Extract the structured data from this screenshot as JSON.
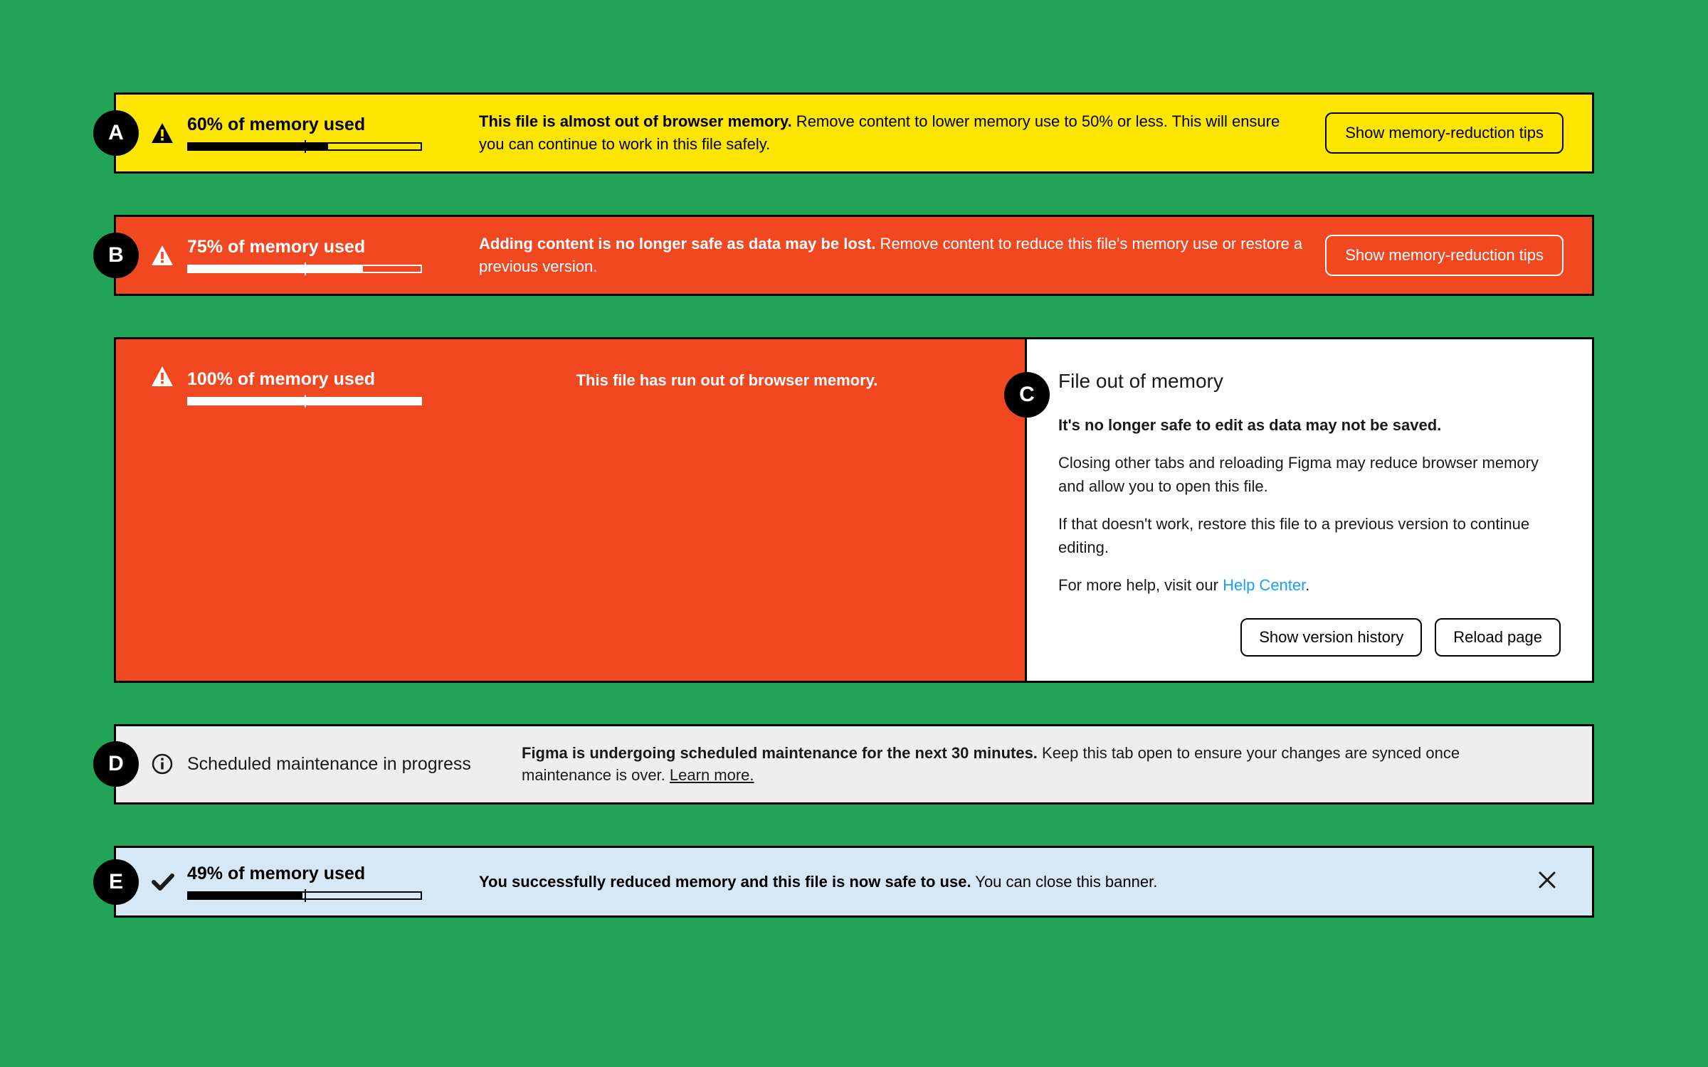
{
  "a": {
    "badge": "A",
    "percent": 60,
    "tick": 50,
    "heading": "60% of memory used",
    "bold": "This file is almost out of browser memory.",
    "rest": " Remove content to lower memory use to 50% or less. This will ensure you can continue to work in this file safely.",
    "button": "Show memory-reduction tips"
  },
  "b": {
    "badge": "B",
    "percent": 75,
    "tick": 50,
    "heading": "75% of memory used",
    "bold": "Adding content is no longer safe as data may be lost.",
    "rest": " Remove content to reduce this file's memory use or restore a previous version.",
    "button": "Show memory-reduction tips"
  },
  "c_banner": {
    "percent": 100,
    "tick": 50,
    "heading": "100% of memory used",
    "bold": "This file has run out of browser memory."
  },
  "c_dialog": {
    "badge": "C",
    "title": "File out of memory",
    "p1_bold": "It's no longer safe to edit as data may not be saved.",
    "p2": "Closing other tabs and reloading Figma may reduce browser memory and allow you to open this file.",
    "p3": "If that doesn't work, restore this file to a previous version to continue editing.",
    "p4_prefix": "For more help, visit our ",
    "p4_link": "Help Center",
    "p4_suffix": ".",
    "btn1": "Show version history",
    "btn2": "Reload page"
  },
  "d": {
    "badge": "D",
    "heading": "Scheduled maintenance in progress",
    "bold": "Figma is undergoing scheduled maintenance for the next 30 minutes.",
    "rest": " Keep this tab open to ensure your changes are synced once maintenance is over. ",
    "link": "Learn more."
  },
  "e": {
    "badge": "E",
    "percent": 49,
    "tick": 50,
    "heading": "49% of memory used",
    "bold": "You successfully reduced memory and this file is now safe to use.",
    "rest": " You can close this banner."
  }
}
